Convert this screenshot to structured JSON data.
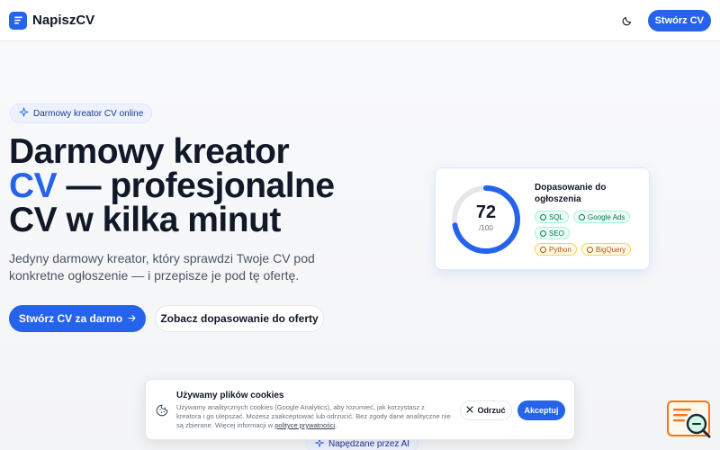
{
  "header": {
    "brand_name": "NapiszCV",
    "cta_label": "Stwórz CV"
  },
  "icons": {
    "logo": "document-lines-icon",
    "theme": "moon-icon",
    "badge": "sparkle-icon",
    "arrow": "arrow-right-icon",
    "cookie": "cookie-icon",
    "close": "close-icon",
    "check": "check-circle-icon",
    "warn": "alert-circle-icon",
    "fab": "cv-search-icon"
  },
  "hero": {
    "badge": "Darmowy kreator CV online",
    "title_line1": "Darmowy kreator",
    "title_accent": "CV",
    "title_line2_rest": " — profesjonalne",
    "title_line3": "CV w kilka minut",
    "subtitle": "Jedyny darmowy kreator, który sprawdzi Twoje CV pod konkretne ogłoszenie — i przepisze je pod tę ofertę.",
    "primary_cta": "Stwórz CV za darmo",
    "secondary_cta": "Zobacz dopasowanie do oferty"
  },
  "score_card": {
    "score": "72",
    "max": "/100",
    "fraction": 0.72,
    "title": "Dopasowanie do ogłoszenia",
    "matched_tags": [
      "SQL",
      "Google Ads",
      "SEO"
    ],
    "missing_tags": [
      "Python",
      "BigQuery"
    ]
  },
  "cookie_banner": {
    "title": "Używamy plików cookies",
    "text": "Używamy analitycznych cookies (Google Analytics), aby rozumieć, jak korzystasz z kreatora i go ulepszać. Możesz zaakceptować lub odrzucić. Bez zgody dane analityczne nie są zbierane. Więcej informacji w ",
    "policy_link": "polityce prywatności",
    "text_end": ".",
    "reject_label": "Odrzuć",
    "accept_label": "Akceptuj"
  },
  "ai_badge": "Napędzane przez AI",
  "colors": {
    "accent": "#2563eb",
    "ok": "#047857",
    "warn": "#b45309"
  }
}
